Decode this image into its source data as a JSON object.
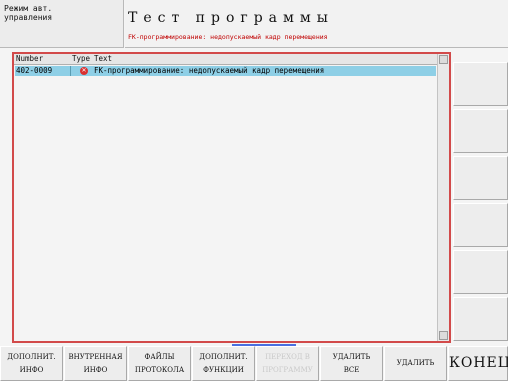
{
  "header": {
    "mode_label": "Режим авт.\nуправления",
    "title": "Тест программы",
    "message": "FK-программирование: недопускаемый кадр перемещения"
  },
  "table": {
    "columns": [
      "Number",
      "Type",
      "Text"
    ],
    "rows": [
      {
        "number": "402-0009",
        "type_icon": "error-icon",
        "text": "FK-программирование: недопускаемый кадр перемещения",
        "selected": true
      }
    ]
  },
  "softkeys": [
    {
      "line1": "ДОПОЛНИТ.",
      "line2": "ИНФО",
      "enabled": true
    },
    {
      "line1": "ВНУТРЕННАЯ",
      "line2": "ИНФО",
      "enabled": true
    },
    {
      "line1": "ФАЙЛЫ",
      "line2": "ПРОТОКОЛА",
      "enabled": true
    },
    {
      "line1": "ДОПОЛНИТ.",
      "line2": "ФУНКЦИИ",
      "enabled": true
    },
    {
      "line1": "ПЕРЕХОД В",
      "line2": "ПРОГРАММУ",
      "enabled": false
    },
    {
      "line1": "УДАЛИТЬ",
      "line2": "ВСЕ",
      "enabled": true
    },
    {
      "line1": "УДАЛИТЬ",
      "line2": "",
      "enabled": true
    },
    {
      "line1": "КОНЕЦ",
      "line2": "",
      "enabled": true
    }
  ],
  "colors": {
    "error_text": "#c00000",
    "selection": "#8ecfe6",
    "panel_border": "#d24a4a",
    "focus": "#4a6ee0"
  }
}
